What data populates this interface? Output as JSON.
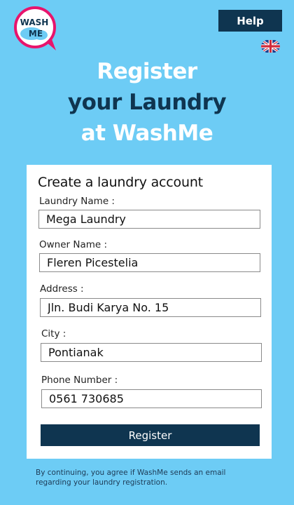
{
  "logo": {
    "line1": "WASH",
    "line2": "ME"
  },
  "header": {
    "help_label": "Help",
    "language_icon": "uk-flag-icon"
  },
  "headline": {
    "line1": "Register",
    "line2": "your Laundry",
    "line3": "at WashMe"
  },
  "form": {
    "title": "Create a laundry account",
    "fields": [
      {
        "label": "Laundry Name :",
        "value": "Mega Laundry"
      },
      {
        "label": "Owner Name :",
        "value": "Fleren Picestelia"
      },
      {
        "label": "Address :",
        "value": "Jln. Budi Karya No. 15"
      },
      {
        "label": "City :",
        "value": "Pontianak"
      },
      {
        "label": "Phone Number :",
        "value": "0561 730685"
      }
    ],
    "register_label": "Register"
  },
  "disclaimer": "By continuing, you agree if WashMe sends an email regarding your laundry registration.",
  "colors": {
    "background": "#6dccf5",
    "primary": "#0f3550",
    "logo_ring": "#e8146c"
  }
}
